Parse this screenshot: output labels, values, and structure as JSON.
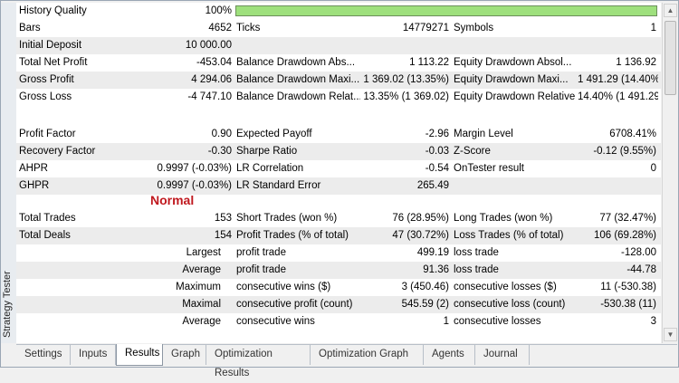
{
  "window": {
    "side_title": "Strategy Tester",
    "model_label": "Normal"
  },
  "colors": {
    "history_quality_bar": "#9ee07d",
    "model_label": "#c0191f"
  },
  "history_quality": {
    "label": "History Quality",
    "value": "100%",
    "fill_percent": 100
  },
  "rows1": [
    {
      "a": "Bars",
      "av": "4652",
      "b": "Ticks",
      "bv": "14779271",
      "c": "Symbols",
      "cv": "1",
      "shade": false
    },
    {
      "a": "Initial Deposit",
      "av": "10 000.00",
      "b": "",
      "bv": "",
      "c": "",
      "cv": "",
      "shade": true
    },
    {
      "a": "Total Net Profit",
      "av": "-453.04",
      "b": "Balance Drawdown Abs...",
      "bv": "1 113.22",
      "c": "Equity Drawdown Absol...",
      "cv": "1 136.92",
      "shade": false
    },
    {
      "a": "Gross Profit",
      "av": "4 294.06",
      "b": "Balance Drawdown Maxi...",
      "bv": "1 369.02 (13.35%)",
      "c": "Equity Drawdown Maxi...",
      "cv": "1 491.29 (14.40%)",
      "shade": true
    },
    {
      "a": "Gross Loss",
      "av": "-4 747.10",
      "b": "Balance Drawdown Relat...",
      "bv": "13.35% (1 369.02)",
      "c": "Equity Drawdown Relative",
      "cv": "14.40% (1 491.29)",
      "shade": false
    }
  ],
  "rows2": [
    {
      "a": "Profit Factor",
      "av": "0.90",
      "b": "Expected Payoff",
      "bv": "-2.96",
      "c": "Margin Level",
      "cv": "6708.41%",
      "shade": false
    },
    {
      "a": "Recovery Factor",
      "av": "-0.30",
      "b": "Sharpe Ratio",
      "bv": "-0.03",
      "c": "Z-Score",
      "cv": "-0.12 (9.55%)",
      "shade": true
    },
    {
      "a": "AHPR",
      "av": "0.9997 (-0.03%)",
      "b": "LR Correlation",
      "bv": "-0.54",
      "c": "OnTester result",
      "cv": "0",
      "shade": false
    },
    {
      "a": "GHPR",
      "av": "0.9997 (-0.03%)",
      "b": "LR Standard Error",
      "bv": "265.49",
      "c": "",
      "cv": "",
      "shade": true
    }
  ],
  "rows3": [
    {
      "a": "Total Trades",
      "av": "153",
      "b": "Short Trades (won %)",
      "bv": "76 (28.95%)",
      "c": "Long Trades (won %)",
      "cv": "77 (32.47%)",
      "shade": false
    },
    {
      "a": "Total Deals",
      "av": "154",
      "b": "Profit Trades (% of total)",
      "bv": "47 (30.72%)",
      "c": "Loss Trades (% of total)",
      "cv": "106 (69.28%)",
      "shade": true
    }
  ],
  "rows4": [
    {
      "r": "Largest",
      "b": "profit trade",
      "bv": "499.19",
      "c": "loss trade",
      "cv": "-128.00",
      "shade": false
    },
    {
      "r": "Average",
      "b": "profit trade",
      "bv": "91.36",
      "c": "loss trade",
      "cv": "-44.78",
      "shade": true
    },
    {
      "r": "Maximum",
      "b": "consecutive wins ($)",
      "bv": "3 (450.46)",
      "c": "consecutive losses ($)",
      "cv": "11 (-530.38)",
      "shade": false
    },
    {
      "r": "Maximal",
      "b": "consecutive profit (count)",
      "bv": "545.59 (2)",
      "c": "consecutive loss (count)",
      "cv": "-530.38 (11)",
      "shade": true
    },
    {
      "r": "Average",
      "b": "consecutive wins",
      "bv": "1",
      "c": "consecutive losses",
      "cv": "3",
      "shade": false
    }
  ],
  "tabs": [
    {
      "label": "Settings",
      "active": false
    },
    {
      "label": "Inputs",
      "active": false
    },
    {
      "label": "Results",
      "active": true
    },
    {
      "label": "Graph",
      "active": false
    },
    {
      "label": "Optimization Results",
      "active": false
    },
    {
      "label": "Optimization Graph",
      "active": false
    },
    {
      "label": "Agents",
      "active": false
    },
    {
      "label": "Journal",
      "active": false
    }
  ]
}
